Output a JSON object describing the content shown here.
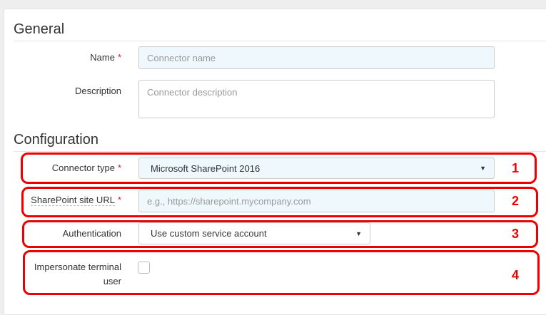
{
  "general": {
    "heading": "General",
    "name": {
      "label": "Name",
      "required": "*",
      "placeholder": "Connector name"
    },
    "description": {
      "label": "Description",
      "placeholder": "Connector description"
    }
  },
  "configuration": {
    "heading": "Configuration",
    "connector_type": {
      "label": "Connector type",
      "required": "*",
      "value": "Microsoft SharePoint 2016"
    },
    "site_url": {
      "label": "SharePoint site URL",
      "required": "*",
      "placeholder": "e.g., https://sharepoint.mycompany.com"
    },
    "authentication": {
      "label": "Authentication",
      "value": "Use custom service account"
    },
    "impersonate": {
      "label": "Impersonate terminal user",
      "checked": false
    }
  },
  "annotations": [
    "1",
    "2",
    "3",
    "4"
  ],
  "colors": {
    "annotation": "#ee0000",
    "required": "#d9232d",
    "input_bg": "#eef8fd"
  }
}
